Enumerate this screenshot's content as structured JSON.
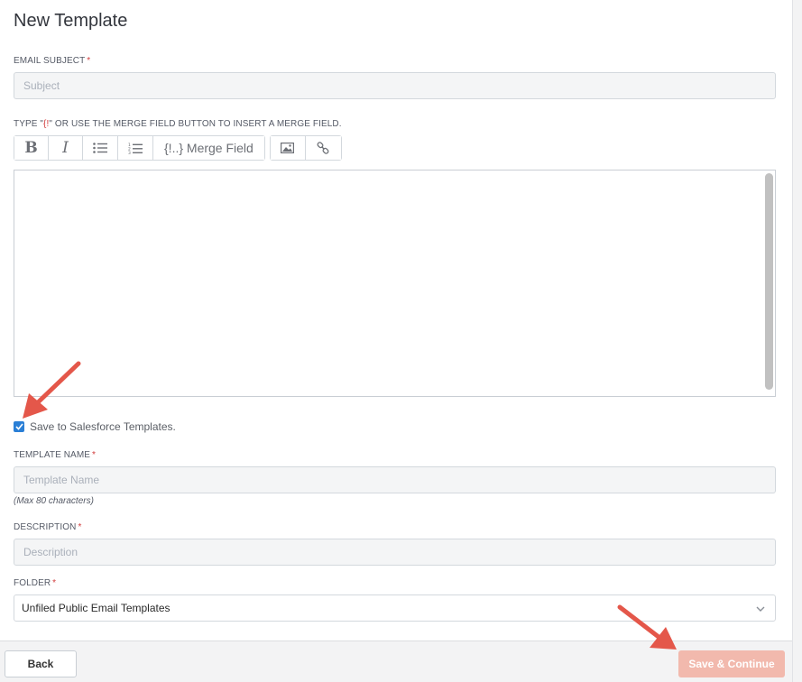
{
  "page": {
    "title": "New Template"
  },
  "subject": {
    "label": "EMAIL SUBJECT",
    "required": "*",
    "placeholder": "Subject",
    "value": ""
  },
  "body_hint": {
    "prefix": "TYPE \"",
    "code": "{!",
    "suffix": "\" OR USE THE MERGE FIELD BUTTON TO INSERT A MERGE FIELD."
  },
  "toolbar": {
    "bold": "B",
    "italic": "I",
    "bullet_list_icon": "bulleted-list-icon",
    "numbered_list_icon": "numbered-list-icon",
    "merge_field": "{!..} Merge Field",
    "image_icon": "image-icon",
    "link_icon": "link-icon"
  },
  "save_to_templates": {
    "checked": true,
    "label": "Save to Salesforce Templates."
  },
  "template_name": {
    "label": "TEMPLATE NAME",
    "required": "*",
    "placeholder": "Template Name",
    "hint": "(Max 80 characters)"
  },
  "description": {
    "label": "DESCRIPTION",
    "required": "*",
    "placeholder": "Description"
  },
  "folder": {
    "label": "FOLDER",
    "required": "*",
    "selected": "Unfiled Public Email Templates"
  },
  "footer": {
    "back": "Back",
    "save_continue": "Save & Continue"
  },
  "colors": {
    "accent": "#2a7fd6",
    "required": "#d23c3c",
    "save_disabled": "#f2b9ad",
    "annotation_arrow": "#e4574a"
  }
}
